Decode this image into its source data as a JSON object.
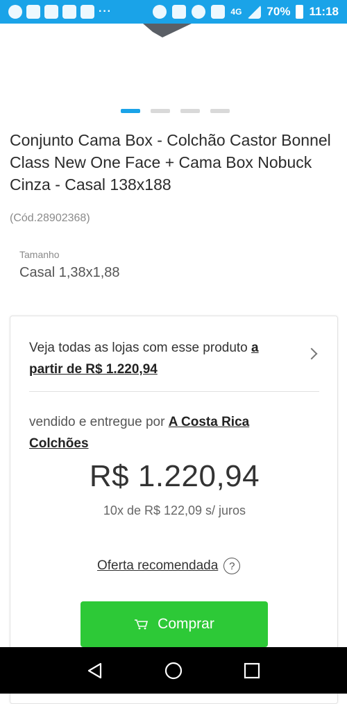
{
  "status_bar": {
    "icons": [
      "whatsapp-icon",
      "facebook-icon",
      "facebook-icon",
      "apps-icon",
      "gmail-icon",
      "do-not-disturb-icon",
      "vibrate-icon",
      "alarm-icon",
      "wifi-call-icon",
      "signal-icon",
      "battery-icon"
    ],
    "more": "···",
    "network": "4G",
    "battery": "70%",
    "time": "11:18",
    "background": "#1aa3e8"
  },
  "carousel": {
    "total": 4,
    "active_index": 0,
    "active_color": "#1aa3e8"
  },
  "product": {
    "title": "Conjunto Cama Box - Colchão Castor Bonnel Class New One Face + Cama Box Nobuck Cinza - Casal 138x188",
    "code": "(Cód.28902368)",
    "size_label": "Tamanho",
    "size_value": "Casal 1,38x1,88"
  },
  "offer": {
    "all_stores_text": "Veja todas as lojas com esse produto ",
    "all_stores_link": "a partir de R$ 1.220,94",
    "seller_text": "vendido e entregue por ",
    "seller_name": "A Costa Rica Colchões",
    "price": "R$ 1.220,94",
    "installments": "10x de R$ 122,09 s/ juros",
    "recommended_label": "Oferta recomendada",
    "help_glyph": "?",
    "buy_label": "Comprar",
    "buy_color": "#2dc937"
  },
  "nav": {
    "back": "back-icon",
    "home": "home-icon",
    "recents": "recents-icon"
  }
}
